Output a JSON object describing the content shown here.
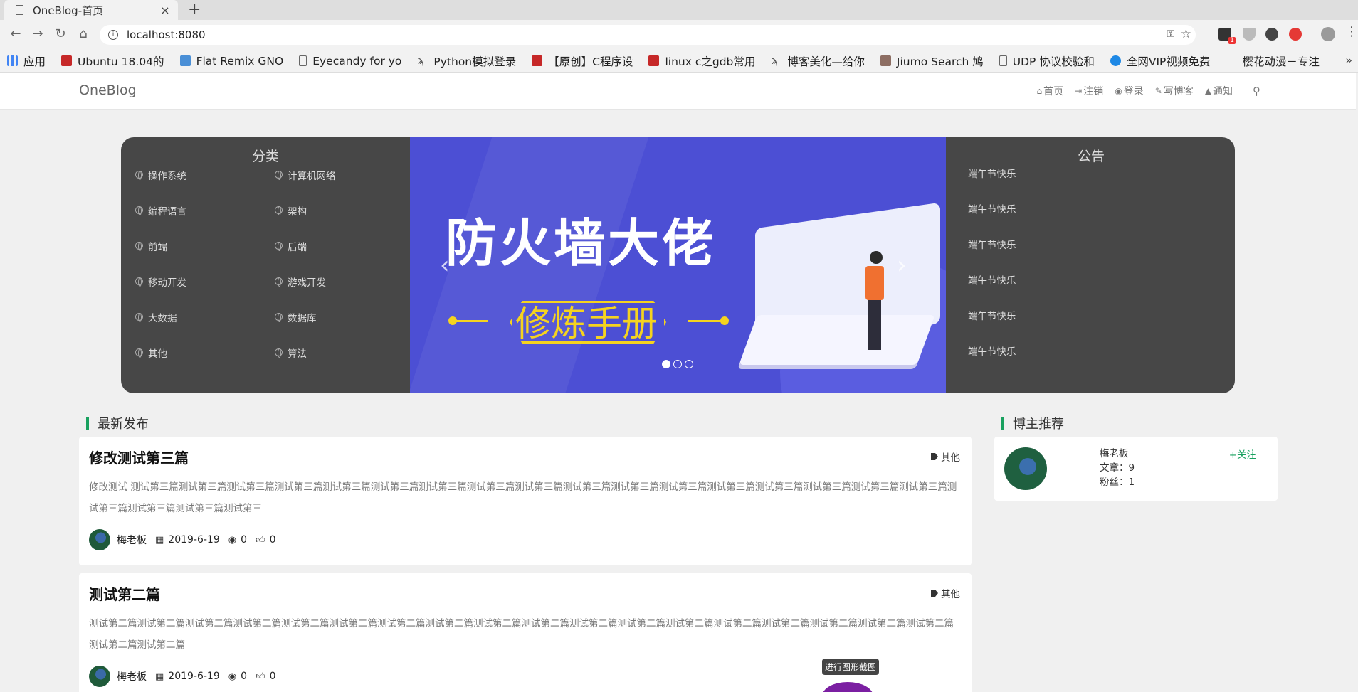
{
  "browser": {
    "tab_title": "OneBlog-首页",
    "tab_close": "×",
    "new_tab": "+",
    "url": "localhost:8080",
    "url_port": ":8080",
    "bookmarks": [
      {
        "label": "应用",
        "icon": "apps-grid-icon"
      },
      {
        "label": "Ubuntu 18.04的",
        "icon": "csdn-icon"
      },
      {
        "label": "Flat Remix GNO",
        "icon": "image-icon"
      },
      {
        "label": "Eyecandy for yo",
        "icon": "document-icon"
      },
      {
        "label": "Python模拟登录",
        "icon": "lambda-icon"
      },
      {
        "label": "【原创】C程序设",
        "icon": "csdn-icon"
      },
      {
        "label": "linux c之gdb常用",
        "icon": "csdn-icon"
      },
      {
        "label": "博客美化—给你",
        "icon": "lambda-icon"
      },
      {
        "label": "Jiumo Search 鸠",
        "icon": "jiumo-icon"
      },
      {
        "label": "UDP 协议校验和",
        "icon": "document-icon"
      },
      {
        "label": "全网VIP视频免费",
        "icon": "cloud-icon"
      },
      {
        "label": "樱花动漫－专注",
        "icon": "blank-icon"
      }
    ],
    "bookmarks_more": "»"
  },
  "site": {
    "brand": "OneBlog",
    "nav": [
      {
        "label": "首页",
        "icon": "home-icon"
      },
      {
        "label": "注销",
        "icon": "sign-out-icon"
      },
      {
        "label": "登录",
        "icon": "user-circle-icon"
      },
      {
        "label": "写博客",
        "icon": "pencil-icon"
      },
      {
        "label": "通知",
        "icon": "bell-icon"
      }
    ]
  },
  "hero": {
    "categories_title": "分类",
    "categories": [
      "操作系统",
      "计算机网络",
      "编程语言",
      "架构",
      "前端",
      "后端",
      "移动开发",
      "游戏开发",
      "大数据",
      "数据库",
      "其他",
      "算法"
    ],
    "slide": {
      "title": "防火墙大佬",
      "subtitle": "修炼手册"
    },
    "notices_title": "公告",
    "notices": [
      "端午节快乐",
      "端午节快乐",
      "端午节快乐",
      "端午节快乐",
      "端午节快乐",
      "端午节快乐"
    ]
  },
  "latest": {
    "heading": "最新发布",
    "articles": [
      {
        "title": "修改测试第三篇",
        "tag": "其他",
        "body": "修改测试 测试第三篇测试第三篇测试第三篇测试第三篇测试第三篇测试第三篇测试第三篇测试第三篇测试第三篇测试第三篇测试第三篇测试第三篇测试第三篇测试第三篇测试第三篇测试第三篇测试第三篇测试第三篇测试第三篇测试第三篇测试第三",
        "author": "梅老板",
        "date": "2019-6-19",
        "views": "0",
        "likes": "0"
      },
      {
        "title": "测试第二篇",
        "tag": "其他",
        "body": "测试第二篇测试第二篇测试第二篇测试第二篇测试第二篇测试第二篇测试第二篇测试第二篇测试第二篇测试第二篇测试第二篇测试第二篇测试第二篇测试第二篇测试第二篇测试第二篇测试第二篇测试第二篇测试第二篇测试第二篇",
        "author": "梅老板",
        "date": "2019-6-19",
        "views": "0",
        "likes": "0"
      }
    ]
  },
  "recommend": {
    "heading": "博主推荐",
    "name": "梅老板",
    "articles": "文章：9",
    "fans": "粉丝：1",
    "follow": "+关注"
  },
  "tooltip": "进行图形截图"
}
